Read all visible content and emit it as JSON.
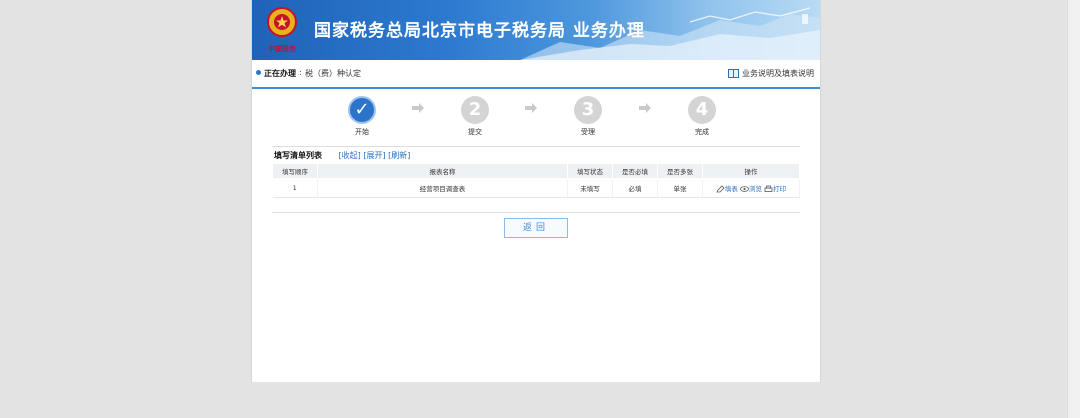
{
  "header": {
    "title": "国家税务总局北京市电子税务局  业务办理",
    "emblem_text": "中国税务"
  },
  "breadcrumb": {
    "label": "正在办理",
    "colon": ":",
    "value": "税（费）种认定",
    "help_link": "业务说明及填表说明"
  },
  "steps": [
    {
      "number": "✓",
      "label": "开始",
      "active": true
    },
    {
      "number": "2",
      "label": "提交",
      "active": false
    },
    {
      "number": "3",
      "label": "受理",
      "active": false
    },
    {
      "number": "4",
      "label": "完成",
      "active": false
    }
  ],
  "form_list": {
    "title": "填写清单列表",
    "links": {
      "collapse": "收起",
      "expand": "展开",
      "refresh": "刷新"
    },
    "columns": [
      "填写顺序",
      "报表名称",
      "填写状态",
      "是否必填",
      "是否多张",
      "操作"
    ],
    "rows": [
      {
        "order": "1",
        "name": "经营项目调查表",
        "status": "未填写",
        "required": "必填",
        "multiple": "单张",
        "actions": {
          "fill": "填表",
          "view": "浏览",
          "print": "打印"
        }
      }
    ]
  },
  "buttons": {
    "back": "返回"
  },
  "colors": {
    "accent": "#2b74c9",
    "banner": "#2d7ad0",
    "link": "#2a6fc0"
  }
}
